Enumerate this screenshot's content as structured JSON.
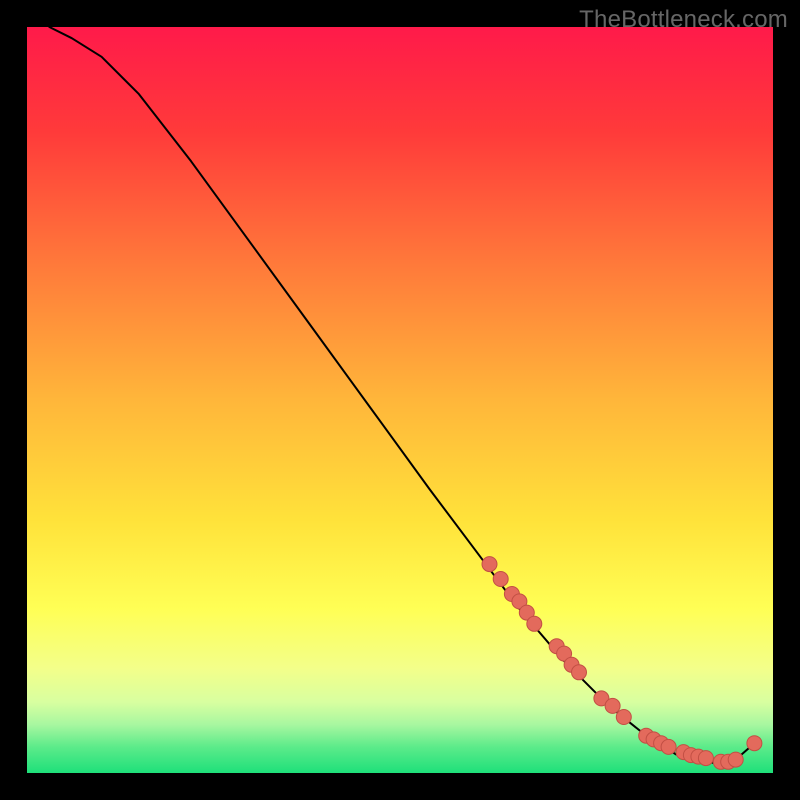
{
  "watermark": "TheBottleneck.com",
  "colors": {
    "top": "#ff1a4a",
    "mid_upper": "#ff8a3a",
    "mid": "#ffd93a",
    "mid_lower": "#ffff70",
    "bottom": "#1ee07a",
    "curve": "#000000",
    "marker": "#e36a5c",
    "marker_stroke": "#c24f44"
  },
  "chart_data": {
    "type": "line",
    "title": "",
    "xlabel": "",
    "ylabel": "",
    "xlim": [
      0,
      100
    ],
    "ylim": [
      0,
      100
    ],
    "series": [
      {
        "name": "curve",
        "x": [
          3,
          6,
          10,
          15,
          22,
          30,
          38,
          46,
          54,
          60,
          66,
          72,
          78,
          83,
          87,
          90,
          93,
          95,
          97.5
        ],
        "y": [
          100,
          98.5,
          96,
          91,
          82,
          71,
          60,
          49,
          38,
          30,
          22,
          15,
          9,
          5,
          2.5,
          1.5,
          1.3,
          1.8,
          4
        ]
      }
    ],
    "markers": {
      "name": "highlighted-points",
      "x": [
        62,
        63.5,
        65,
        66,
        67,
        68,
        71,
        72,
        73,
        74,
        77,
        78.5,
        80,
        83,
        84,
        85,
        86,
        88,
        89,
        90,
        91,
        93,
        94,
        95,
        97.5
      ],
      "y": [
        28,
        26,
        24,
        23,
        21.5,
        20,
        17,
        16,
        14.5,
        13.5,
        10,
        9,
        7.5,
        5,
        4.5,
        4,
        3.5,
        2.8,
        2.4,
        2.2,
        2.0,
        1.5,
        1.5,
        1.8,
        4
      ]
    }
  }
}
